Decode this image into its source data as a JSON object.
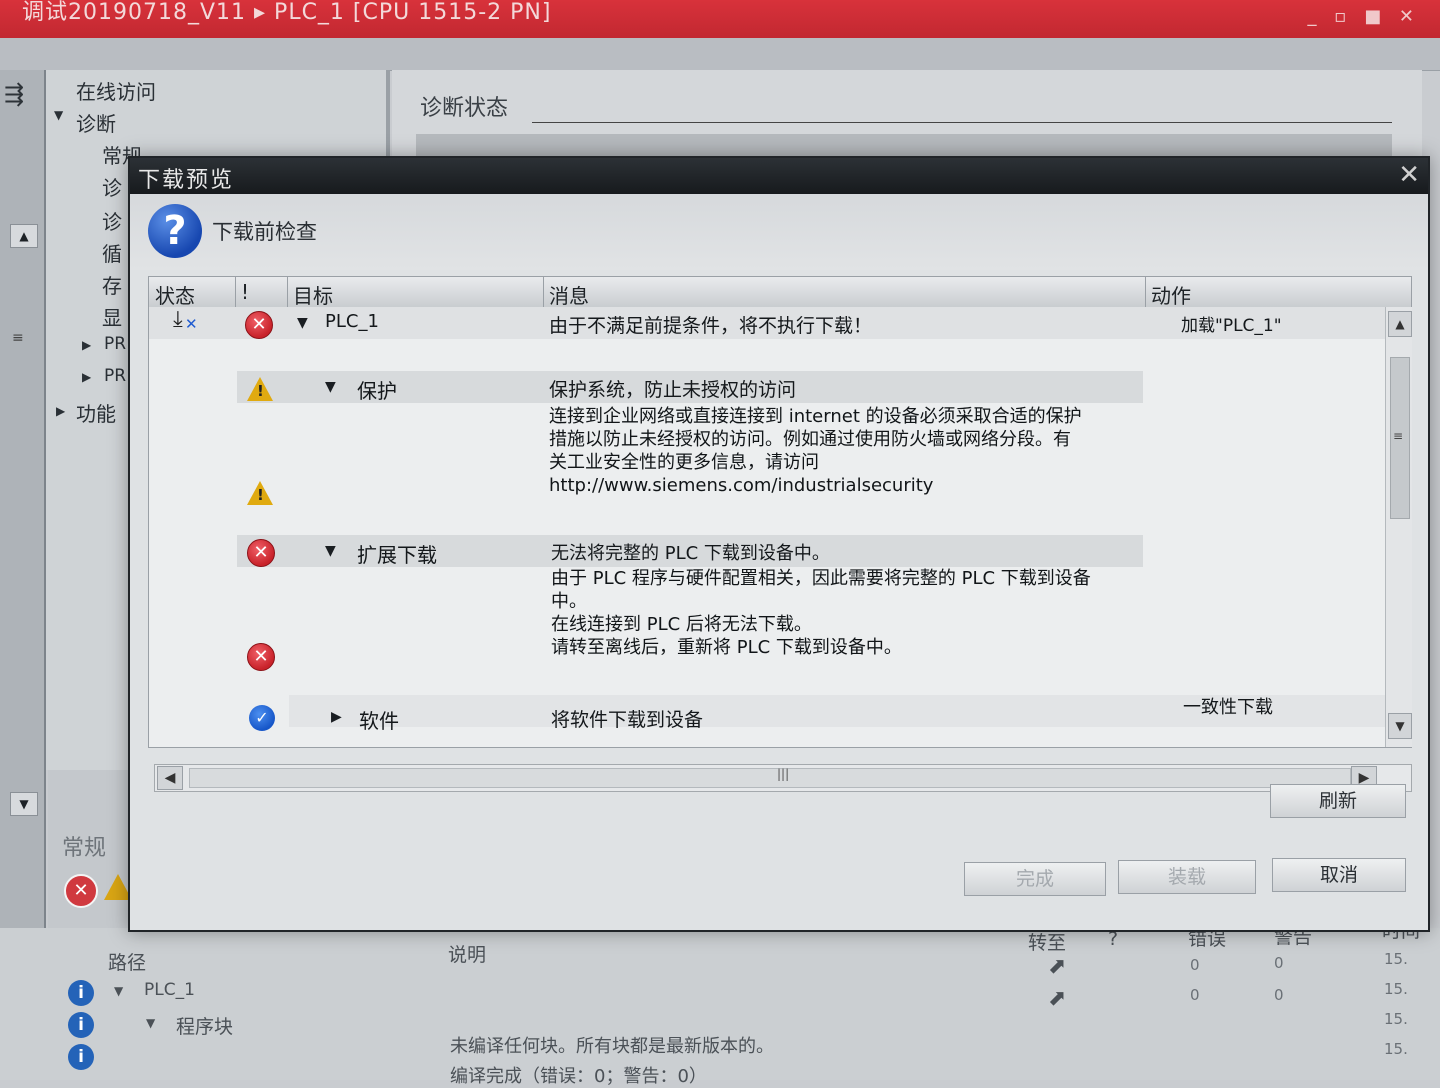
{
  "app": {
    "title": "调试20190718_V11 ▸ PLC_1 [CPU 1515-2 PN]",
    "window_controls": "_ ▫ ■ ✕"
  },
  "nav": {
    "items": [
      "在线访问",
      "诊断",
      "常规",
      "诊",
      "诊",
      "循",
      "存",
      "显",
      "PR",
      "PR",
      "功能"
    ]
  },
  "diag": {
    "title": "诊断状态"
  },
  "dialog": {
    "title": "下载预览",
    "subtitle": "下载前检查",
    "columns": {
      "status": "状态",
      "excl": "!",
      "target": "目标",
      "message": "消息",
      "action": "动作"
    },
    "rows": [
      {
        "target": "PLC_1",
        "message": "由于不满足前提条件，将不执行下载！",
        "action": "加载\"PLC_1\""
      },
      {
        "target": "保护",
        "message": "保护系统，防止未授权的访问"
      },
      {
        "message_lines": [
          "连接到企业网络或直接连接到 internet 的设备必须采取合适的保护",
          "措施以防止未经授权的访问。例如通过使用防火墙或网络分段。有",
          "关工业安全性的更多信息，请访问",
          "http://www.siemens.com/industrialsecurity"
        ]
      },
      {
        "target": "扩展下载",
        "message": "无法将完整的 PLC 下载到设备中。"
      },
      {
        "message_lines": [
          "由于 PLC 程序与硬件配置相关，因此需要将完整的 PLC 下载到设备",
          "中。",
          "在线连接到 PLC 后将无法下载。",
          "请转至离线后，重新将 PLC 下载到设备中。"
        ]
      },
      {
        "target": "软件",
        "message": "将软件下载到设备",
        "action": "一致性下载"
      }
    ],
    "buttons": {
      "refresh": "刷新",
      "finish": "完成",
      "load": "装载",
      "cancel": "取消"
    }
  },
  "lower": {
    "tab": "常规",
    "headers": {
      "path": "路径",
      "desc": "说明",
      "goto": "转至",
      "q": "?",
      "errors": "错误",
      "warnings": "警告",
      "time": "时间"
    },
    "tree": [
      "PLC_1",
      "程序块"
    ],
    "msgs": [
      "未编译任何块。所有块都是最新版本的。",
      "编译完成（错误：0；警告：0）"
    ],
    "err_values": [
      "0",
      "0"
    ],
    "warn_values": [
      "0",
      "0"
    ],
    "times": [
      "15.",
      "15.",
      "15.",
      "15."
    ]
  }
}
